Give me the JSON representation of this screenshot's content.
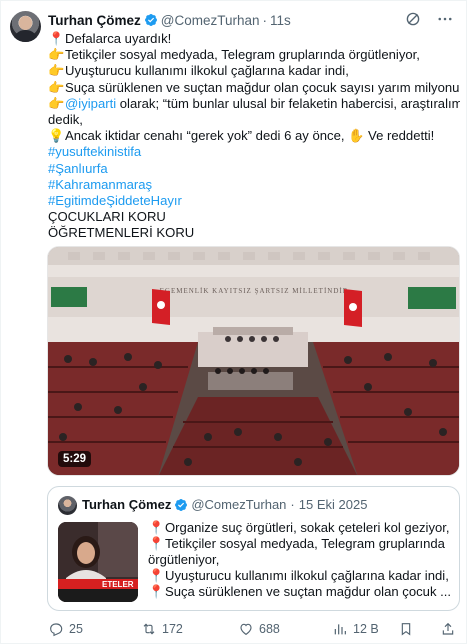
{
  "author": {
    "name": "Turhan Çömez",
    "handle": "@ComezTurhan",
    "separator": "·",
    "time": "11s"
  },
  "tweet_lines": [
    {
      "emoji": "📍",
      "text": "Defalarca uyardık!"
    },
    {
      "emoji": "👉",
      "text": "Tetikçiler sosyal medyada, Telegram gruplarında örgütleniyor,"
    },
    {
      "emoji": "👉",
      "text": "Uyuşturucu kullanımı ilkokul çağlarına kadar indi,"
    },
    {
      "emoji": "👉",
      "text": "Suça sürüklenen ve suçtan mağdur olan çocuk sayısı yarım milyonu aştı!"
    },
    {
      "emoji": "👉",
      "mention": "@iyiparti",
      "text": " olarak; “tüm bunlar ulusal bir felaketin habercisi, araştıralım”"
    },
    {
      "emoji": "",
      "text": "dedik,"
    },
    {
      "emoji": "💡",
      "text": "Ancak iktidar cenahı “gerek yok” dedi 6 ay önce, ✋ Ve reddetti!"
    }
  ],
  "hashtags": [
    "#yusuftekinistifa",
    "#Şanlıurfa",
    "#Kahramanmaraş",
    "#EgitimdeŞiddeteHayır"
  ],
  "closing_lines": [
    "ÇOCUKLARI KORU",
    "ÖĞRETMENLERİ KORU"
  ],
  "media": {
    "banner_text": "EGEMENLİK KAYITSIZ ŞARTSIZ MİLLETİNDİR",
    "duration": "5:29"
  },
  "quote": {
    "name": "Turhan Çömez",
    "handle": "@ComezTurhan",
    "separator": "·",
    "time": "15 Eki 2025",
    "thumb_caption": "ETELER",
    "lines": [
      {
        "emoji": "📍",
        "text": "Organize suç örgütleri, sokak çeteleri kol geziyor,"
      },
      {
        "emoji": "📍",
        "text": "Tetikçiler sosyal medyada, Telegram gruplarında"
      },
      {
        "emoji": "",
        "text": "örgütleniyor,"
      },
      {
        "emoji": "📍",
        "text": "Uyuşturucu kullanımı ilkokul çağlarına kadar indi,"
      },
      {
        "emoji": "📍",
        "text": "Suça sürüklenen ve suçtan mağdur olan çocuk ..."
      }
    ]
  },
  "actions": {
    "replies": "25",
    "reposts": "172",
    "likes": "688",
    "views": "12 B"
  },
  "colors": {
    "link": "#1d9bf0",
    "secondary_text": "#536471",
    "verified_badge": "#1d9bf0"
  }
}
